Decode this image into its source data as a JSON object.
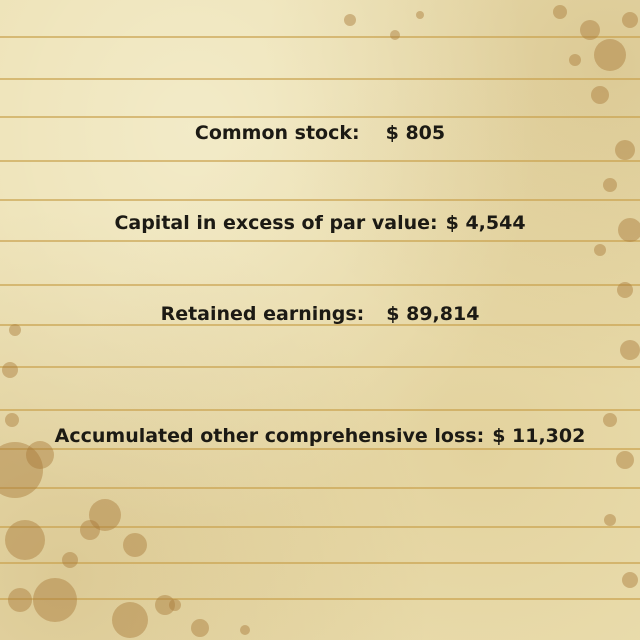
{
  "items": [
    {
      "label": "Common stock:",
      "value": "$ 805"
    },
    {
      "label": "Capital in excess of par value:",
      "value": "$ 4,544"
    },
    {
      "label": "Retained earnings:",
      "value": "$ 89,814"
    },
    {
      "label": "Accumulated other comprehensive loss:",
      "value": "$ 11,302"
    }
  ],
  "colors": {
    "paper": "#ece0b2",
    "rule_line": "#c9a14d",
    "stain": "#a97a3a",
    "text": "#1c1a14"
  }
}
